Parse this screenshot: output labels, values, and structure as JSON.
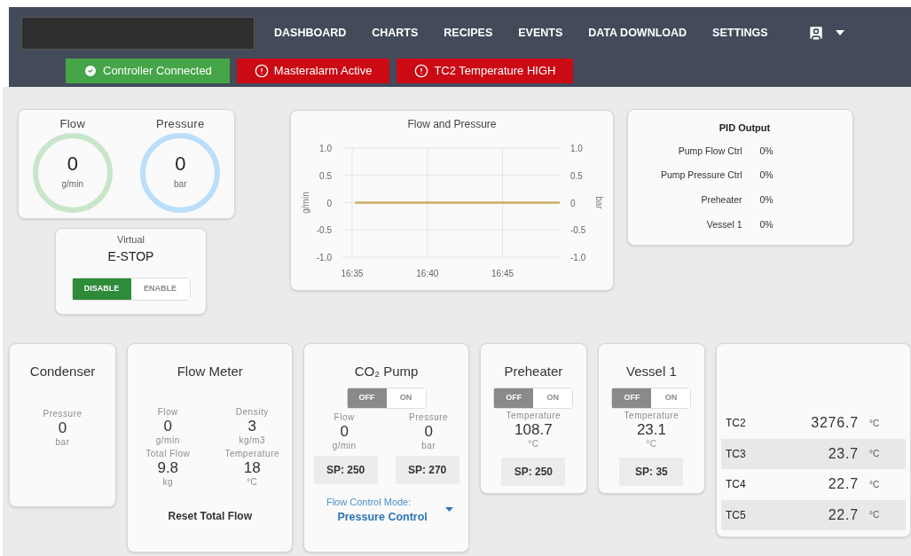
{
  "nav": {
    "items": [
      "DASHBOARD",
      "CHARTS",
      "RECIPES",
      "EVENTS",
      "DATA DOWNLOAD",
      "SETTINGS"
    ]
  },
  "status_badges": [
    {
      "kind": "ok",
      "label": "Controller Connected"
    },
    {
      "kind": "alarm",
      "label": "Masteralarm Active"
    },
    {
      "kind": "alarm",
      "label": "TC2 Temperature HIGH"
    }
  ],
  "gauges": [
    {
      "label": "Flow",
      "value": "0",
      "unit": "g/min",
      "color": "#c8e6c9"
    },
    {
      "label": "Pressure",
      "value": "0",
      "unit": "bar",
      "color": "#bbdefb"
    }
  ],
  "estop": {
    "subtitle": "Virtual",
    "title": "E-STOP",
    "options": [
      {
        "label": "DISABLE",
        "selected": true
      },
      {
        "label": "ENABLE",
        "selected": false
      }
    ]
  },
  "flow_pressure_chart": {
    "chart_data": {
      "type": "line",
      "title": "Flow and Pressure",
      "ylabel": "g/min",
      "y2label": "bar",
      "grid": true,
      "x": [
        995.2,
        1008.8
      ],
      "xlim": [
        994.35,
        1008.8
      ],
      "ylim": [
        -1.0,
        1.0
      ],
      "y2lim": [
        -1.0,
        1.0
      ],
      "xticks": [
        {
          "value": 995,
          "label": "16:35"
        },
        {
          "value": 1000,
          "label": "16:40"
        },
        {
          "value": 1005,
          "label": "16:45"
        }
      ],
      "yticks": [
        {
          "value": 1,
          "label": "1.0"
        },
        {
          "value": 0.5,
          "label": "0.5"
        },
        {
          "value": 0,
          "label": "0"
        },
        {
          "value": -0.5,
          "label": "-0.5"
        },
        {
          "value": -1,
          "label": "-1.0"
        }
      ],
      "y2ticks": [
        {
          "value": 1,
          "label": "1.0"
        },
        {
          "value": 0.5,
          "label": "0.5"
        },
        {
          "value": 0,
          "label": "0"
        },
        {
          "value": -0.5,
          "label": "-0.5"
        },
        {
          "value": -1,
          "label": "-1.0"
        }
      ],
      "series": [
        {
          "color": "#c8ad62",
          "values": [
            0,
            0
          ]
        }
      ]
    }
  },
  "pid_output": {
    "title": "PID Output",
    "rows": [
      {
        "label": "Pump Flow Ctrl",
        "value": "0%"
      },
      {
        "label": "Pump Pressure Ctrl",
        "value": "0%"
      },
      {
        "label": "Preheater",
        "value": "0%"
      },
      {
        "label": "Vessel 1",
        "value": "0%"
      }
    ]
  },
  "condenser": {
    "title": "Condenser",
    "readings": [
      {
        "label": "Pressure",
        "value": "0",
        "unit": "bar"
      }
    ]
  },
  "flow_meter": {
    "title": "Flow Meter",
    "readings": [
      {
        "label": "Flow",
        "value": "0",
        "unit": "g/min"
      },
      {
        "label": "Density",
        "value": "3",
        "unit": "kg/m3"
      },
      {
        "label": "Total Flow",
        "value": "9.8",
        "unit": "kg"
      },
      {
        "label": "Temperature",
        "value": "18",
        "unit": "°C"
      }
    ],
    "button": "Reset Total Flow"
  },
  "co2_pump": {
    "title": "CO₂ Pump",
    "toggle": [
      {
        "label": "OFF",
        "selected": true
      },
      {
        "label": "ON",
        "selected": false
      }
    ],
    "readings": [
      {
        "label": "Flow",
        "value": "0",
        "unit": "g/min"
      },
      {
        "label": "Pressure",
        "value": "0",
        "unit": "bar"
      }
    ],
    "setpoints": [
      "SP: 250",
      "SP: 270"
    ],
    "mode": {
      "label": "Flow Control Mode:",
      "value": "Pressure Control"
    }
  },
  "preheater": {
    "title": "Preheater",
    "toggle": [
      {
        "label": "OFF",
        "selected": true
      },
      {
        "label": "ON",
        "selected": false
      }
    ],
    "readings": [
      {
        "label": "Temperature",
        "value": "108.7",
        "unit": "°C"
      }
    ],
    "setpoints": [
      "SP: 250"
    ]
  },
  "vessel_1": {
    "title": "Vessel 1",
    "toggle": [
      {
        "label": "OFF",
        "selected": true
      },
      {
        "label": "ON",
        "selected": false
      }
    ],
    "readings": [
      {
        "label": "Temperature",
        "value": "23.1",
        "unit": "°C"
      }
    ],
    "setpoints": [
      "SP: 35"
    ]
  },
  "thermocouples": [
    {
      "name": "TC2",
      "value": "3276.7",
      "unit": "°C"
    },
    {
      "name": "TC3",
      "value": "23.7",
      "unit": "°C"
    },
    {
      "name": "TC4",
      "value": "22.7",
      "unit": "°C"
    },
    {
      "name": "TC5",
      "value": "22.7",
      "unit": "°C"
    }
  ]
}
